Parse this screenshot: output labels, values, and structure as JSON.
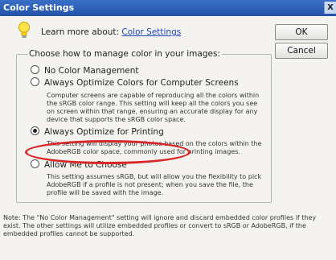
{
  "window": {
    "title": "Color Settings",
    "close_glyph": "X"
  },
  "header": {
    "learn_prefix": "Learn more about: ",
    "learn_link": "Color Settings",
    "icon": "lightbulb-icon"
  },
  "buttons": {
    "ok": "OK",
    "cancel": "Cancel"
  },
  "group": {
    "legend": "Choose how to manage color in your images:",
    "options": [
      {
        "label": "No Color Management",
        "selected": false,
        "description": ""
      },
      {
        "label": "Always Optimize Colors for Computer Screens",
        "selected": false,
        "description": "Computer screens are capable of reproducing all the colors within the sRGB color range. This setting will keep all the colors you see on screen within that range, ensuring an accurate display for any device that supports the sRGB color space."
      },
      {
        "label": "Always Optimize for Printing",
        "selected": true,
        "description": "This setting will display your photos based on the colors within the AdobeRGB color space, commonly used for printing images."
      },
      {
        "label": "Allow Me to Choose",
        "selected": false,
        "description": "This setting assumes sRGB, but will allow you the flexibility to pick AdobeRGB if a profile is not present; when you save the file, the profile will be saved with the image."
      }
    ]
  },
  "note": "Note: The \"No Color Management\" setting will ignore and discard embedded color profiles if they exist. The other settings will utilize embedded profiles or convert to sRGB or AdobeRGB, if the embedded profiles cannot be supported.",
  "colors": {
    "titlebar": "#2a5cb5",
    "highlight_ellipse": "#d8262a",
    "link": "#1a44b8"
  }
}
